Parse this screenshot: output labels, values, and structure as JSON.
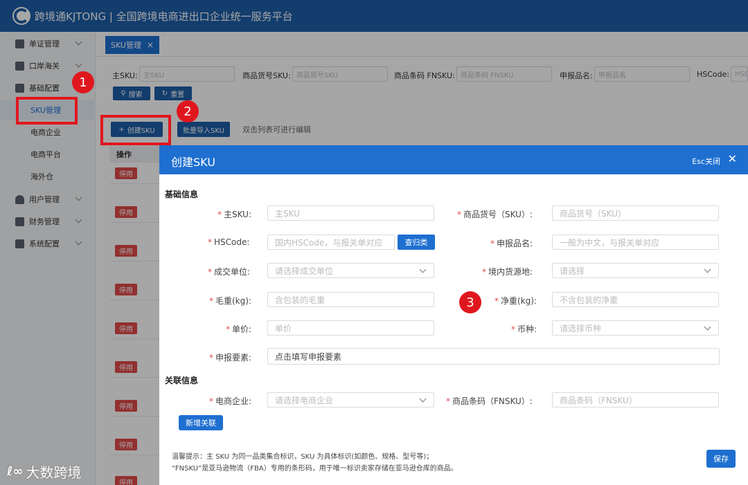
{
  "header": {
    "title": "跨境通KJTONG | 全国跨境电商进出口企业统一服务平台"
  },
  "sidebar": {
    "items": [
      {
        "label": "单证管理"
      },
      {
        "label": "口岸海关"
      },
      {
        "label": "基础配置"
      },
      {
        "label": "用户管理"
      },
      {
        "label": "财务管理"
      },
      {
        "label": "系统配置"
      }
    ],
    "sub_items": [
      {
        "label": "SKU管理"
      },
      {
        "label": "电商企业"
      },
      {
        "label": "电商平台"
      },
      {
        "label": "海外仓"
      }
    ]
  },
  "tabs": [
    {
      "label": "SKU管理",
      "close": "×"
    }
  ],
  "filters": [
    {
      "label": "主SKU:",
      "placeholder": "主SKU"
    },
    {
      "label": "商品货号SKU:",
      "placeholder": "商品货号SKU"
    },
    {
      "label": "商品条码 FNSKU:",
      "placeholder": "商品条码 FNSKU"
    },
    {
      "label": "申报品名:",
      "placeholder": "申报品名"
    },
    {
      "label": "HSCode:",
      "placeholder": "HSC"
    }
  ],
  "buttons": {
    "search": "搜索",
    "reset": "重置",
    "create_sku": "创建SKU",
    "batch_import": "批量导入SKU",
    "hint": "双击列表可进行编辑"
  },
  "table": {
    "header": "操作",
    "stop_label": "停用"
  },
  "modal": {
    "title": "创建SKU",
    "esc": "Esc关闭",
    "close": "✕",
    "section_basic": "基础信息",
    "section_assoc": "关联信息",
    "fields": {
      "main_sku": {
        "label": "主SKU:",
        "placeholder": "主SKU"
      },
      "goods_sku": {
        "label": "商品货号（SKU）:",
        "placeholder": "商品货号（SKU）"
      },
      "hscode": {
        "label": "HSCode:",
        "placeholder": "国内HSCode，与报关单对应"
      },
      "decl_name": {
        "label": "申报品名:",
        "placeholder": "一般为中文，与报关单对应"
      },
      "unit": {
        "label": "成交单位:",
        "placeholder": "请选择成交单位"
      },
      "origin": {
        "label": "境内货源地:",
        "placeholder": "请选择"
      },
      "gross": {
        "label": "毛重(kg):",
        "placeholder": "含包装的毛重"
      },
      "net": {
        "label": "净重(kg):",
        "placeholder": "不含包装的净重"
      },
      "price": {
        "label": "单价:",
        "placeholder": "单价"
      },
      "currency": {
        "label": "币种:",
        "placeholder": "请选择币种"
      },
      "elements": {
        "label": "申报要素:",
        "value": "点击填写申报要素"
      },
      "ecom": {
        "label": "电商企业:",
        "placeholder": "请选择电商企业"
      },
      "fnsku": {
        "label": "商品条码（FNSKU）:",
        "placeholder": "商品条码（FNSKU）"
      }
    },
    "btn_category": "查归类",
    "btn_add_assoc": "新增关联",
    "tip_line1": "温馨提示：主 SKU 为同一品类集合标识，SKU 为具体标识(如颜色、规格、型号等)；",
    "tip_line2": "“FNSKU”是亚马逊物流（FBA）专用的条形码，用于唯一标识卖家存储在亚马逊仓库的商品。",
    "btn_save": "保存"
  },
  "annotations": {
    "n1": "1",
    "n2": "2",
    "n3": "3"
  },
  "watermark": {
    "text": "大数跨境"
  },
  "colors": {
    "header": "#1e5ea8",
    "primary": "#1e6fd0",
    "danger": "#e04b4b",
    "annotation": "#e0161e"
  }
}
